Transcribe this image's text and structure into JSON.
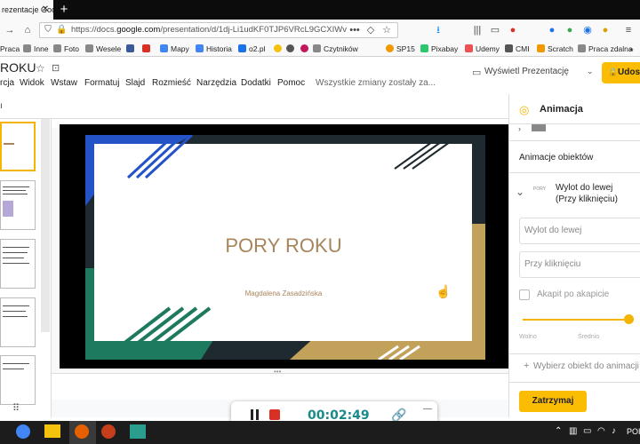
{
  "browser": {
    "tab_title": "rezentacje Goo",
    "url_prefix": "https://docs.",
    "url_domain": "google.com",
    "url_path": "/presentation/d/1dj-Li1udKF0TJP6VRcL9GCXIWvKH..."
  },
  "bookmarks": [
    {
      "label": "Praca",
      "color": "#f5c542"
    },
    {
      "label": "Inne",
      "color": "#888888"
    },
    {
      "label": "Foto",
      "color": "#888888"
    },
    {
      "label": "Wesele",
      "color": "#888888"
    },
    {
      "label": "",
      "color": "#3b5998"
    },
    {
      "label": "",
      "color": "#d93025"
    },
    {
      "label": "Mapy",
      "color": "#4285f4"
    },
    {
      "label": "Historia",
      "color": "#4285f4"
    },
    {
      "label": "o2.pl",
      "color": "#1a73e8"
    },
    {
      "label": "Czytników",
      "color": "#888888"
    },
    {
      "label": "SP15",
      "color": "#f29900"
    },
    {
      "label": "Pixabay",
      "color": "#2ec66d"
    },
    {
      "label": "Udemy",
      "color": "#ec5252"
    },
    {
      "label": "CMI",
      "color": "#555555"
    },
    {
      "label": "Scratch",
      "color": "#f29900"
    },
    {
      "label": "Praca zdalna",
      "color": "#888888"
    }
  ],
  "app": {
    "title": "ROKU",
    "menus": [
      "rcja",
      "Widok",
      "Wstaw",
      "Formatuj",
      "Slajd",
      "Rozmieść",
      "Narzędzia",
      "Dodatki",
      "Pomoc"
    ],
    "saved_message": "Wszystkie zmiany zostały za...",
    "present_label": "Wyświetl Prezentację",
    "share_label": "Udos"
  },
  "slide": {
    "title": "PORY ROKU",
    "author": "Magdalena Zasadzińska",
    "colors": {
      "blue": "#2453c8",
      "green": "#1e7a5e",
      "gold": "#c2a15a",
      "dark": "#1f2a30",
      "title": "#a8845a"
    }
  },
  "panel": {
    "title": "Animacja",
    "objects_heading": "Animacje obiektów",
    "anim_tag": "PORY",
    "anim_name": "Wylot do lewej",
    "anim_trigger": "(Przy kliknięciu)",
    "effect_field": "Wylot do lewej",
    "trigger_field": "Przy kliknięciu",
    "paragraph_label": "Akapit po akapicie",
    "slow_label": "Wolno",
    "medium_label": "Średnio",
    "speed_fraction": 0.95,
    "add_object": "Wybierz obiekt do animacji",
    "stop_button": "Zatrzymaj"
  },
  "recorder": {
    "timer": "00:02:49"
  },
  "taskbar": {
    "tray": "POI"
  }
}
